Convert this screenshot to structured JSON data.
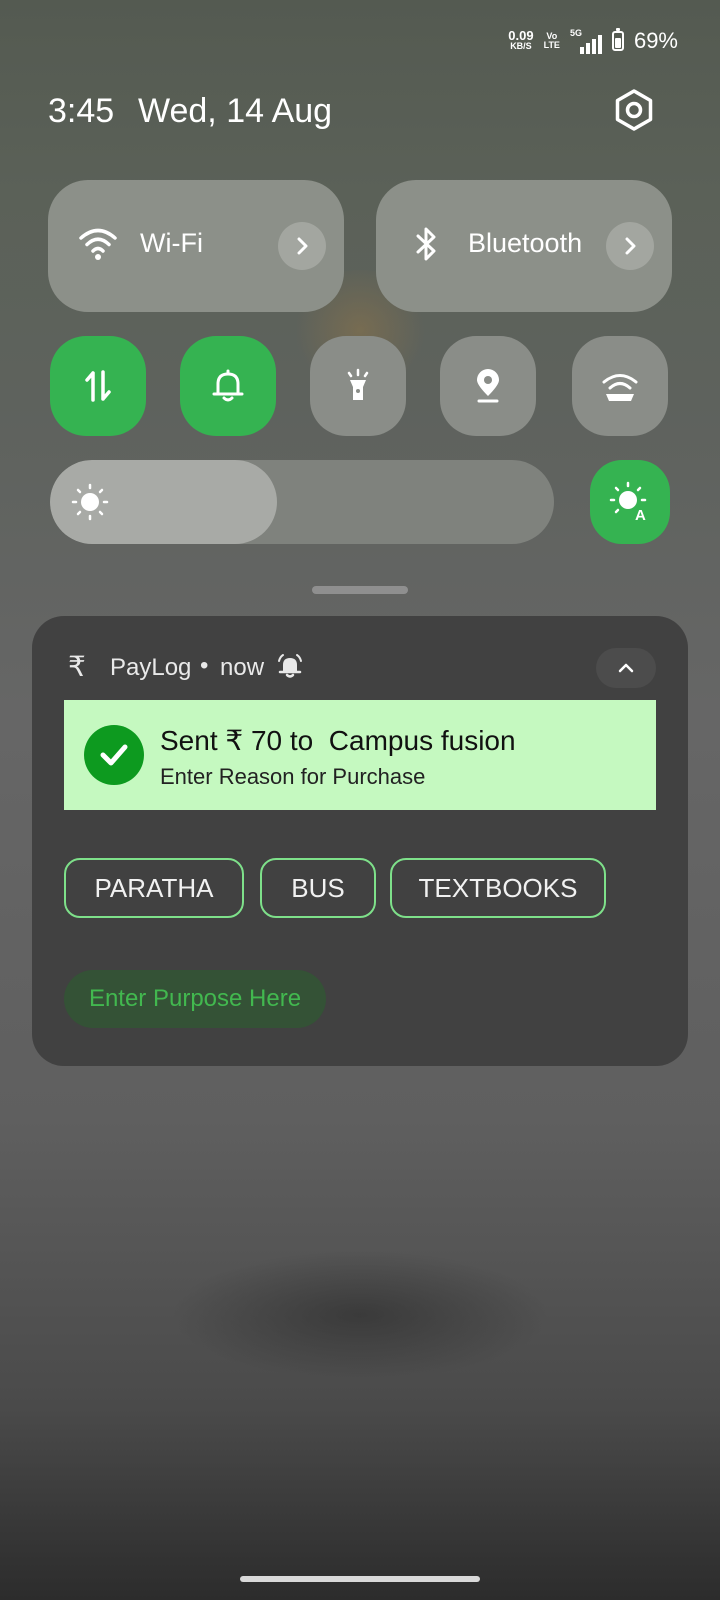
{
  "status_bar": {
    "net_speed_value": "0.09",
    "net_speed_unit": "KB/S",
    "volte_top": "Vo",
    "volte_bottom": "LTE",
    "network_type": "5G",
    "battery_percent": "69%",
    "battery_level": 0.69
  },
  "header": {
    "time": "3:45",
    "date": "Wed, 14 Aug",
    "settings_icon": "gear-icon"
  },
  "quick_settings": {
    "wifi": {
      "label": "Wi-Fi",
      "icon": "wifi-icon"
    },
    "bluetooth": {
      "label": "Bluetooth",
      "icon": "bluetooth-icon"
    },
    "toggles": [
      {
        "name": "mobile-data",
        "icon": "mobile-data-icon",
        "active": true
      },
      {
        "name": "sound",
        "icon": "bell-icon",
        "active": true
      },
      {
        "name": "flashlight",
        "icon": "flashlight-icon",
        "active": false
      },
      {
        "name": "location",
        "icon": "location-icon",
        "active": false
      },
      {
        "name": "hotspot",
        "icon": "hotspot-icon",
        "active": false
      }
    ],
    "brightness_level": 0.45,
    "auto_brightness_active": true,
    "colors": {
      "active": "#35b351",
      "inactive": "#8a8d88"
    }
  },
  "notification": {
    "app_icon": "₹",
    "app_name": "PayLog",
    "separator": "•",
    "time": "now",
    "title": "Sent ₹ 70 to  Campus fusion",
    "subtitle": "Enter Reason for Purchase",
    "chips": [
      "PARATHA",
      "BUS",
      "TEXTBOOKS"
    ],
    "purpose_placeholder": "Enter Purpose Here",
    "colors": {
      "banner": "#c5f9c0",
      "check": "#0d9a1f",
      "chip_border": "#7ee08a",
      "purpose_text": "#42b84f"
    }
  }
}
